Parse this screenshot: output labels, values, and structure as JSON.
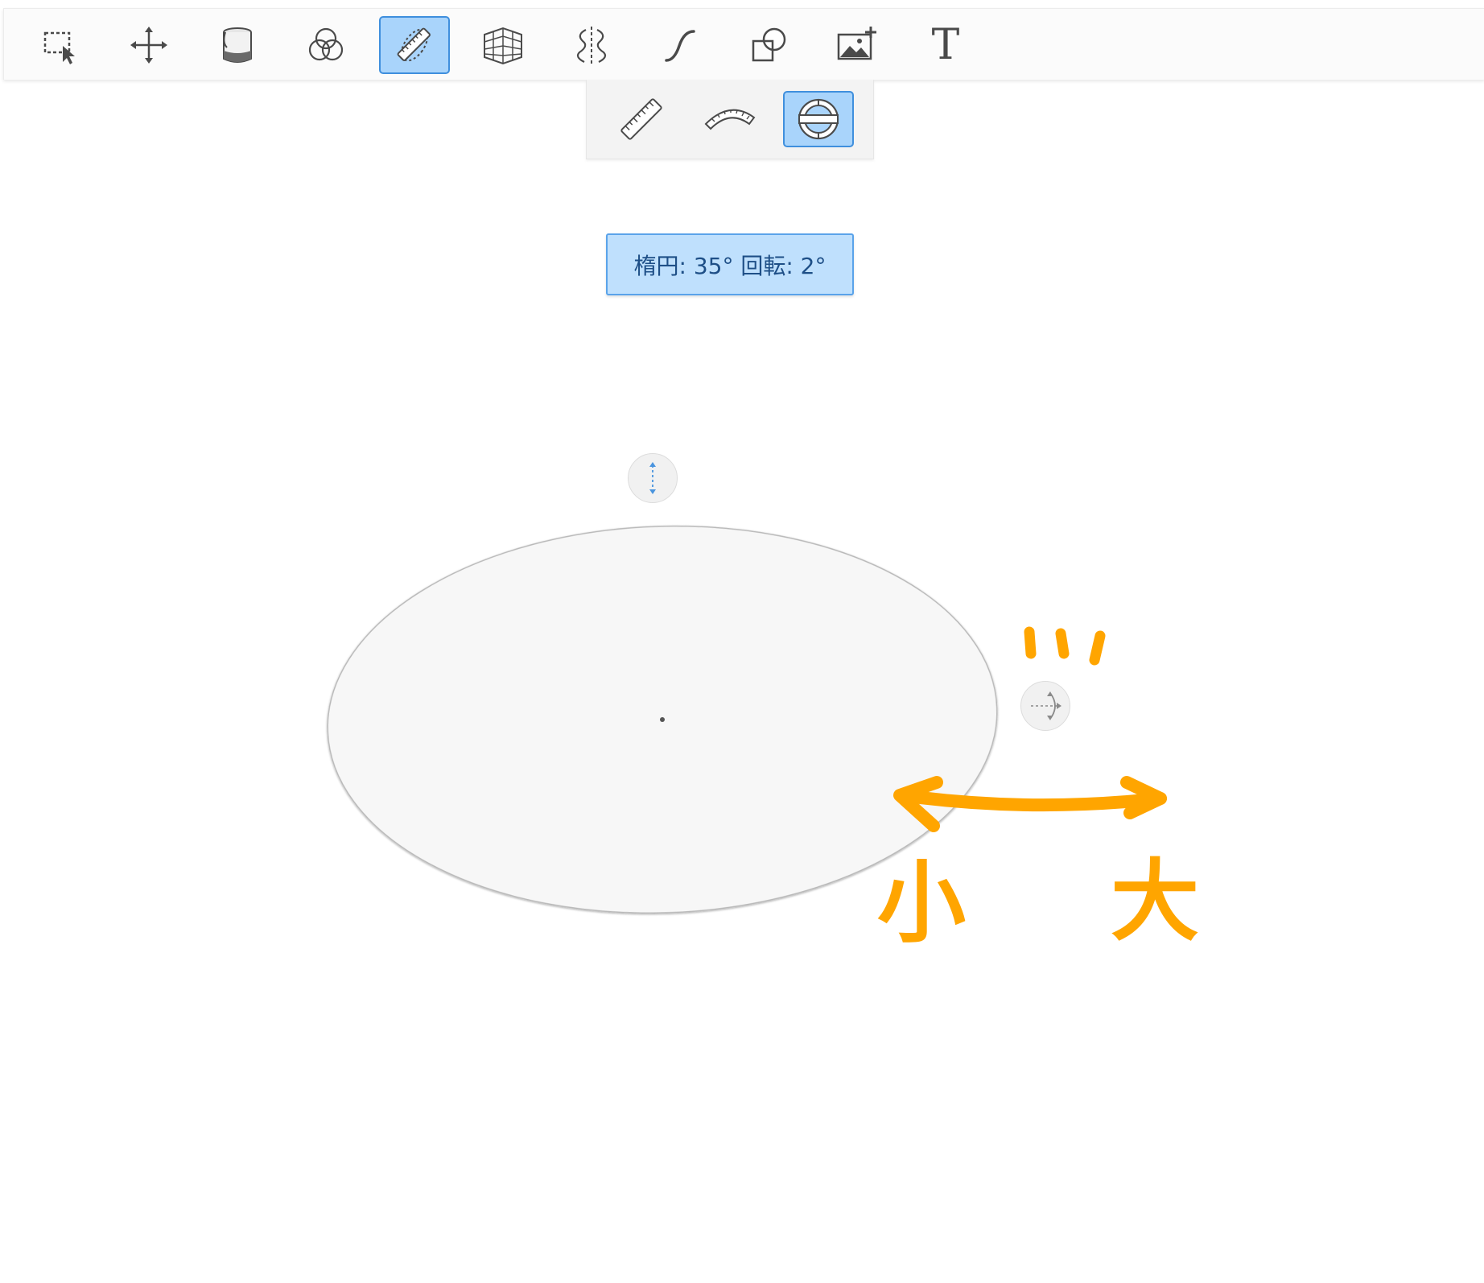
{
  "toolbar": {
    "tools": [
      {
        "name": "selection-tool",
        "icon": "selection-icon"
      },
      {
        "name": "transform-tool",
        "icon": "move-icon"
      },
      {
        "name": "fill-tool",
        "icon": "paint-bucket-icon"
      },
      {
        "name": "blend-tool",
        "icon": "circles-icon"
      },
      {
        "name": "guides-tool",
        "icon": "ruler-ellipse-icon",
        "active": true
      },
      {
        "name": "perspective-tool",
        "icon": "perspective-grid-icon"
      },
      {
        "name": "symmetry-tool",
        "icon": "symmetry-icon"
      },
      {
        "name": "stroke-tool",
        "icon": "curve-icon"
      },
      {
        "name": "shape-tool",
        "icon": "shapes-icon"
      },
      {
        "name": "image-tool",
        "icon": "add-image-icon"
      },
      {
        "name": "text-tool",
        "icon": "text-icon",
        "label": "T"
      }
    ]
  },
  "subtoolbar": {
    "tools": [
      {
        "name": "ruler-guide",
        "icon": "ruler-icon"
      },
      {
        "name": "french-curve-guide",
        "icon": "french-curve-icon"
      },
      {
        "name": "ellipse-guide",
        "icon": "ellipse-guide-icon",
        "active": true
      }
    ]
  },
  "status": {
    "text": "楕円: 35° 回転: 2°"
  },
  "ellipse": {
    "degree": 35,
    "rotation": 2
  },
  "annotations": {
    "small_label": "小",
    "large_label": "大",
    "color": "#ffa500"
  },
  "colors": {
    "accent": "#3f8fdd",
    "active_fill": "#a9d4fb",
    "status_fill": "#bfe0fd",
    "status_text": "#1e4f87"
  }
}
